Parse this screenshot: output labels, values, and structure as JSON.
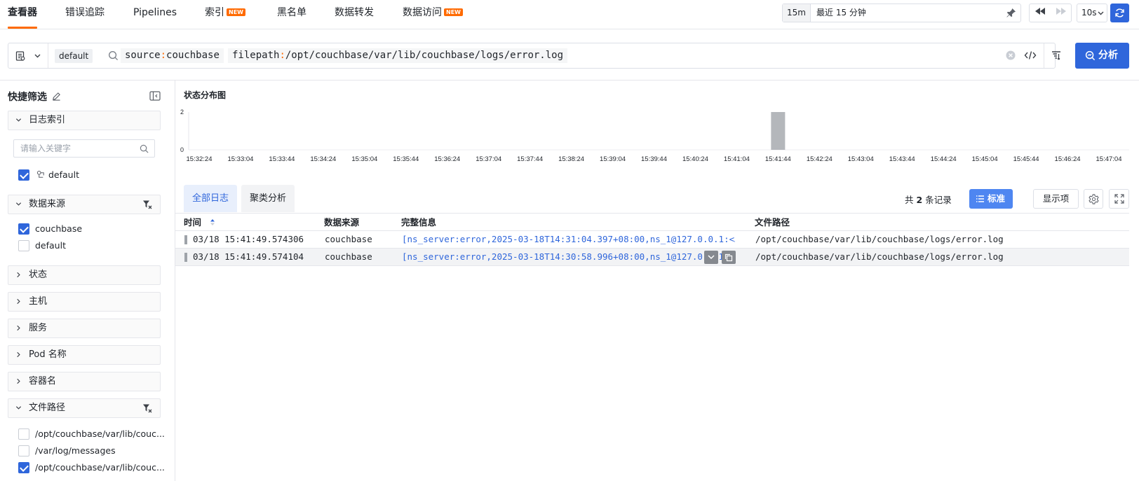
{
  "nav": {
    "tabs": [
      {
        "label": "查看器",
        "new": false,
        "active": true
      },
      {
        "label": "错误追踪",
        "new": false,
        "active": false
      },
      {
        "label": "Pipelines",
        "new": false,
        "active": false
      },
      {
        "label": "索引",
        "new": true,
        "active": false
      },
      {
        "label": "黑名单",
        "new": false,
        "active": false
      },
      {
        "label": "数据转发",
        "new": false,
        "active": false
      },
      {
        "label": "数据访问",
        "new": true,
        "active": false
      }
    ],
    "new_badge": "NEW",
    "time_preset": "15m",
    "time_range": "最近 15 分钟",
    "refresh_interval": "10s"
  },
  "query": {
    "index": "default",
    "tokens": [
      {
        "key": "source",
        "sep": ":",
        "value": "couchbase"
      },
      {
        "key": "filepath",
        "sep": ":",
        "value": "/opt/couchbase/var/lib/couchbase/logs/error.log"
      }
    ],
    "analyze_label": "分析"
  },
  "sidebar": {
    "title": "快捷筛选",
    "facets": {
      "index": {
        "label": "日志索引",
        "expanded": true
      },
      "source": {
        "label": "数据来源",
        "expanded": true
      },
      "status": {
        "label": "状态"
      },
      "host": {
        "label": "主机"
      },
      "service": {
        "label": "服务"
      },
      "pod": {
        "label": "Pod 名称"
      },
      "container": {
        "label": "容器名"
      },
      "filepath": {
        "label": "文件路径",
        "expanded": true
      }
    },
    "search_placeholder": "请输入关键字",
    "index_options": [
      {
        "label": "default",
        "checked": true
      }
    ],
    "source_options": [
      {
        "label": "couchbase",
        "checked": true
      },
      {
        "label": "default",
        "checked": false
      }
    ],
    "filepath_options": [
      {
        "label": "/opt/couchbase/var/lib/couc...",
        "checked": false
      },
      {
        "label": "/var/log/messages",
        "checked": false
      },
      {
        "label": "/opt/couchbase/var/lib/couc...",
        "checked": true
      }
    ]
  },
  "chart_data": {
    "type": "bar",
    "title": "状态分布图",
    "categories": [
      "15:32:24",
      "15:33:04",
      "15:33:44",
      "15:34:24",
      "15:35:04",
      "15:35:44",
      "15:36:24",
      "15:37:04",
      "15:37:44",
      "15:38:24",
      "15:39:04",
      "15:39:44",
      "15:40:24",
      "15:41:04",
      "15:41:44",
      "15:42:24",
      "15:43:04",
      "15:43:44",
      "15:44:24",
      "15:45:04",
      "15:45:44",
      "15:46:24",
      "15:47:04"
    ],
    "series": [
      {
        "values": [
          0,
          0,
          0,
          0,
          0,
          0,
          0,
          0,
          0,
          0,
          0,
          0,
          0,
          0,
          2,
          0,
          0,
          0,
          0,
          0,
          0,
          0,
          0
        ]
      }
    ],
    "yticks": [
      "2",
      "0"
    ],
    "ylim": [
      0,
      2
    ],
    "bar_color": "#b4b7bb",
    "grid": false
  },
  "logs": {
    "tabs": [
      {
        "label": "全部日志",
        "active": true
      },
      {
        "label": "聚类分析",
        "active": false
      }
    ],
    "record_prefix": "共",
    "record_count": "2",
    "record_suffix": "条记录",
    "std_label": "标准",
    "display_label": "显示项",
    "columns": [
      "时间",
      "数据来源",
      "完整信息",
      "文件路径"
    ],
    "rows": [
      {
        "time": "03/18 15:41:49.574306",
        "source": "couchbase",
        "message": "[ns_server:error,2025-03-18T14:31:04.397+08:00,ns_1@127.0.0.1:<…",
        "filepath": "/opt/couchbase/var/lib/couchbase/logs/error.log"
      },
      {
        "time": "03/18 15:41:49.574104",
        "source": "couchbase",
        "message": "[ns_server:error,2025-03-18T14:30:58.996+08:00,ns_1@127.0.0.1:<…",
        "filepath": "/opt/couchbase/var/lib/couchbase/logs/error.log"
      }
    ]
  },
  "colors": {
    "accent": "#2f66db",
    "brand": "#ff6a00"
  }
}
